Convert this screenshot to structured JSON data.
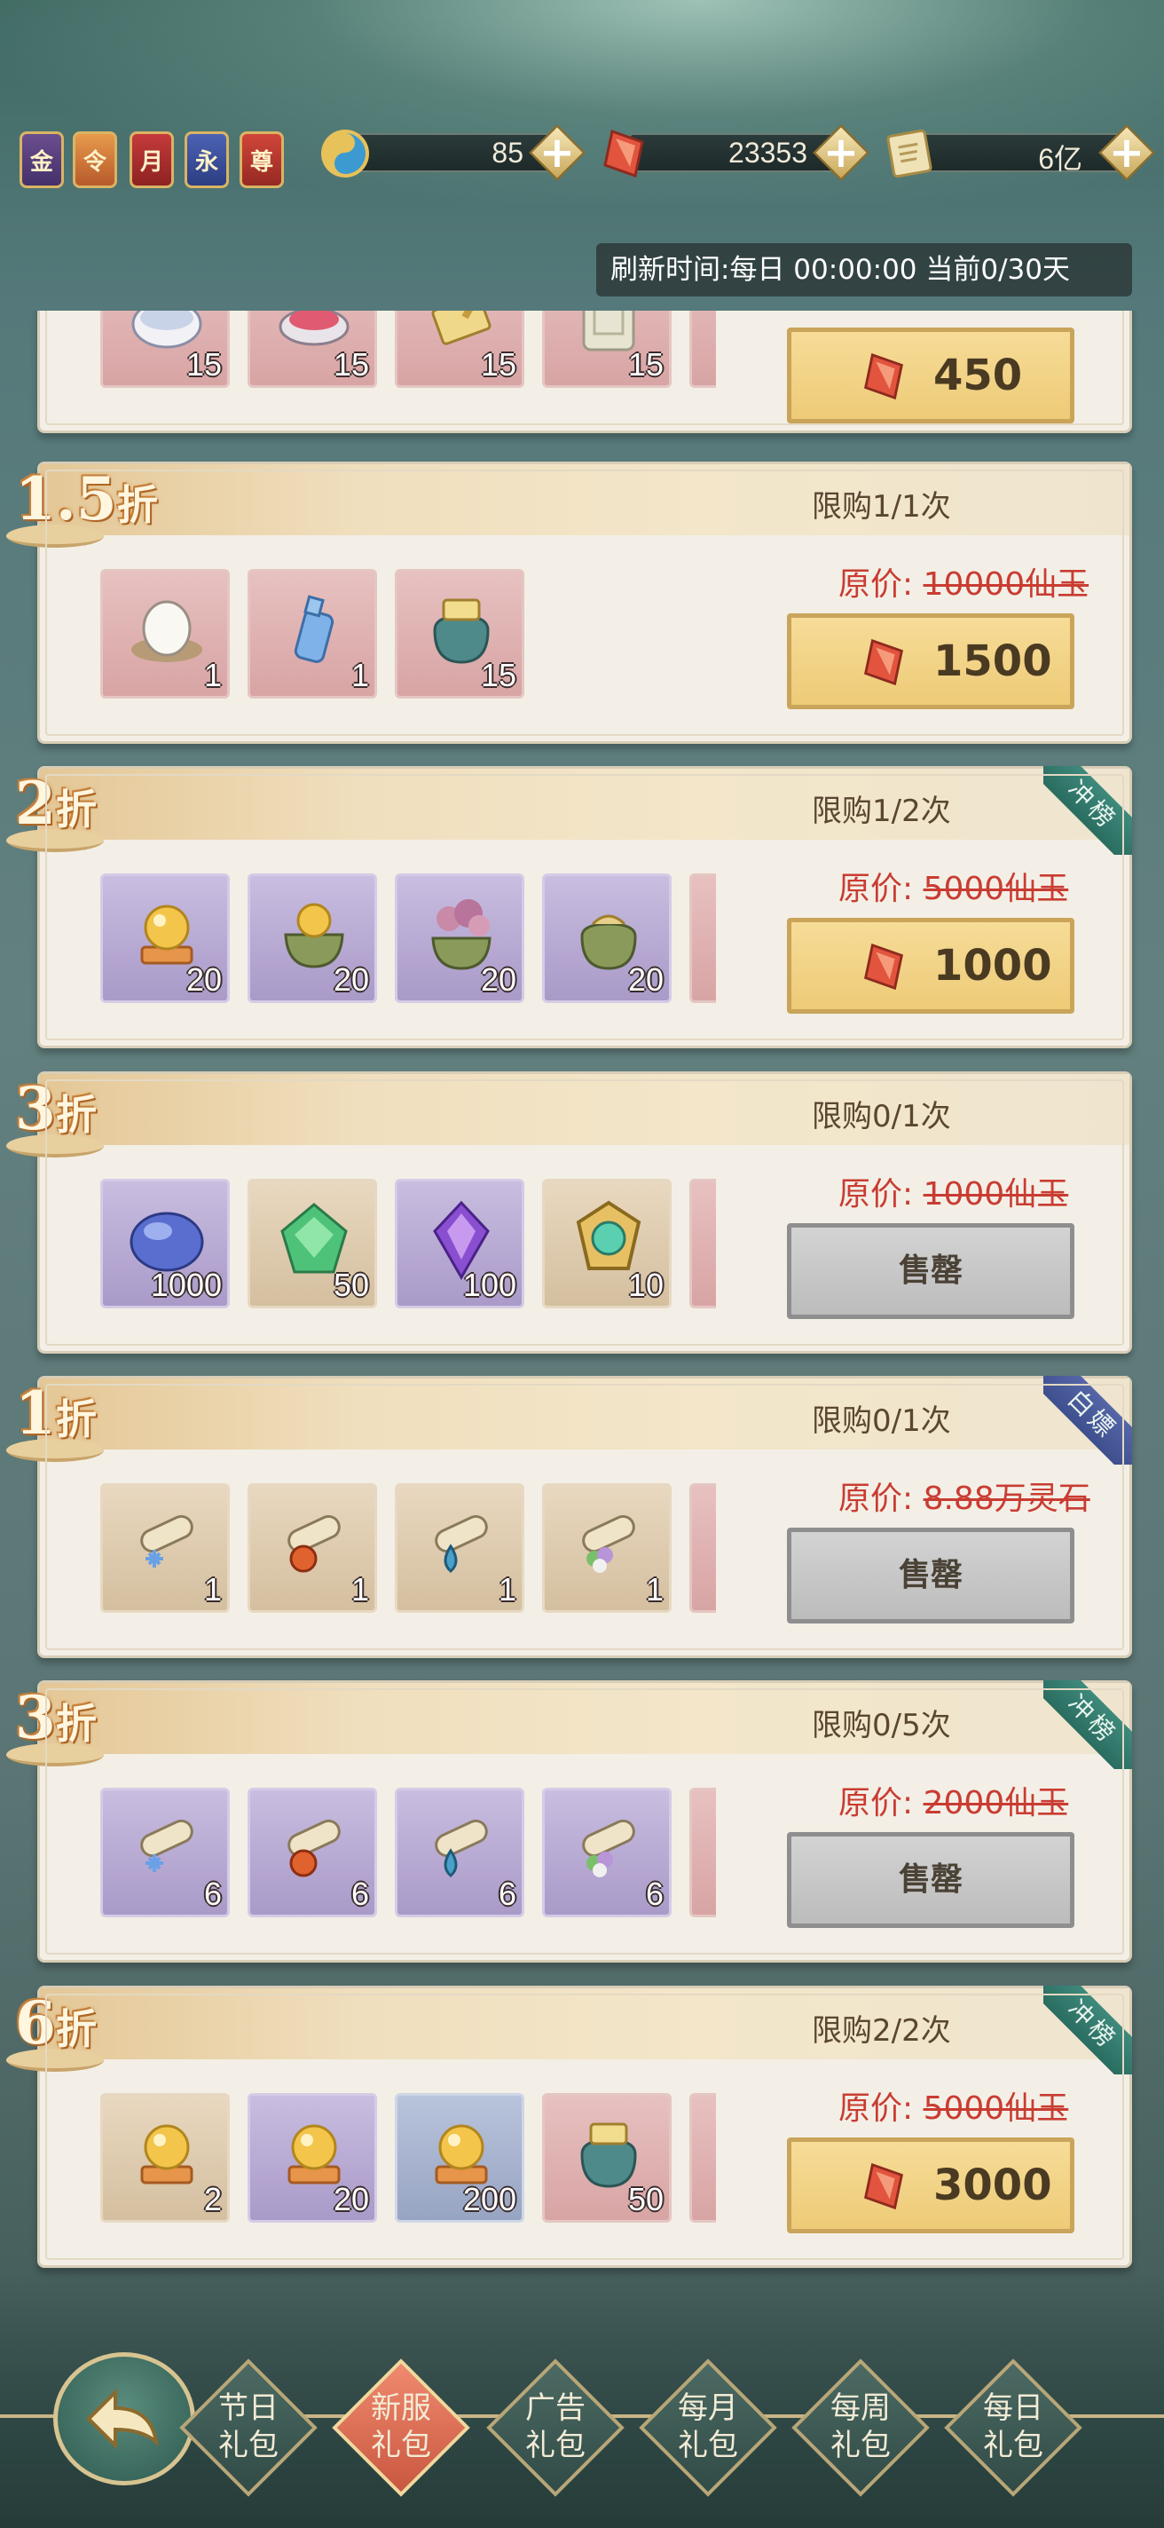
{
  "resources": {
    "badges": [
      "金",
      "令",
      "月",
      "永",
      "尊"
    ],
    "spirit": {
      "value": "85",
      "icon": "spirit-swirl-icon"
    },
    "jade": {
      "value": "23353",
      "icon": "red-jade-icon"
    },
    "stone": {
      "value": "6亿",
      "icon": "scroll-stone-icon"
    }
  },
  "refresh_text": "刷新时间:每日 00:00:00 当前0/30天",
  "packs": [
    {
      "discount": "",
      "zhe": "",
      "limit": "",
      "orig_label": "",
      "orig_value": "",
      "price": "450",
      "sold_out": false,
      "items": [
        {
          "qty": "15",
          "bg": "pink",
          "icon": "porcelain-bowl-icon"
        },
        {
          "qty": "15",
          "bg": "pink",
          "icon": "rouge-box-icon"
        },
        {
          "qty": "15",
          "bg": "pink",
          "icon": "golden-scroll-icon"
        },
        {
          "qty": "15",
          "bg": "pink",
          "icon": "jade-tablet-icon"
        }
      ]
    },
    {
      "discount": "1.5",
      "zhe": "折",
      "limit": "限购1/1次",
      "orig_label": "原价: ",
      "orig_value": "10000仙玉",
      "price": "1500",
      "sold_out": false,
      "tag": "",
      "items": [
        {
          "qty": "1",
          "bg": "pink",
          "icon": "egg-nest-icon"
        },
        {
          "qty": "1",
          "bg": "pink",
          "icon": "blue-bottle-icon"
        },
        {
          "qty": "15",
          "bg": "pink",
          "icon": "treasure-bag-icon"
        }
      ]
    },
    {
      "discount": "2",
      "zhe": "折",
      "limit": "限购1/2次",
      "orig_label": "原价: ",
      "orig_value": "5000仙玉",
      "price": "1000",
      "sold_out": false,
      "tag": "冲榜",
      "tag_color": "green",
      "items": [
        {
          "qty": "20",
          "bg": "purple",
          "icon": "golden-orb-icon"
        },
        {
          "qty": "20",
          "bg": "purple",
          "icon": "orb-cauldron-icon"
        },
        {
          "qty": "20",
          "bg": "purple",
          "icon": "smoke-cauldron-icon"
        },
        {
          "qty": "20",
          "bg": "purple",
          "icon": "green-pouch-icon"
        }
      ]
    },
    {
      "discount": "3",
      "zhe": "折",
      "limit": "限购0/1次",
      "orig_label": "原价: ",
      "orig_value": "1000仙玉",
      "sold_out": true,
      "sold_out_label": "售罄",
      "tag": "",
      "items": [
        {
          "qty": "1000",
          "bg": "purple",
          "icon": "blue-stone-icon"
        },
        {
          "qty": "50",
          "bg": "tan",
          "icon": "green-leaf-gem-icon"
        },
        {
          "qty": "100",
          "bg": "purple",
          "icon": "purple-gem-icon"
        },
        {
          "qty": "10",
          "bg": "tan",
          "icon": "jade-amulet-icon"
        }
      ]
    },
    {
      "discount": "1",
      "zhe": "折",
      "limit": "限购0/1次",
      "orig_label": "原价: ",
      "orig_value": "8.88万灵石",
      "sold_out": true,
      "sold_out_label": "售罄",
      "tag": "白嫖",
      "tag_color": "blue",
      "items": [
        {
          "qty": "1",
          "bg": "tan",
          "icon": "frost-scroll-icon"
        },
        {
          "qty": "1",
          "bg": "tan",
          "icon": "fire-scroll-icon"
        },
        {
          "qty": "1",
          "bg": "tan",
          "icon": "water-scroll-icon"
        },
        {
          "qty": "1",
          "bg": "tan",
          "icon": "flower-scroll-icon"
        }
      ]
    },
    {
      "discount": "3",
      "zhe": "折",
      "limit": "限购0/5次",
      "orig_label": "原价: ",
      "orig_value": "2000仙玉",
      "sold_out": true,
      "sold_out_label": "售罄",
      "tag": "冲榜",
      "tag_color": "green",
      "items": [
        {
          "qty": "6",
          "bg": "purple",
          "icon": "frost-scroll-icon"
        },
        {
          "qty": "6",
          "bg": "purple",
          "icon": "fire-scroll-icon"
        },
        {
          "qty": "6",
          "bg": "purple",
          "icon": "water-scroll-icon"
        },
        {
          "qty": "6",
          "bg": "purple",
          "icon": "flower-scroll-icon"
        }
      ]
    },
    {
      "discount": "6",
      "zhe": "折",
      "limit": "限购2/2次",
      "orig_label": "原价: ",
      "orig_value": "5000仙玉",
      "price": "3000",
      "sold_out": false,
      "tag": "冲榜",
      "tag_color": "green",
      "items": [
        {
          "qty": "2",
          "bg": "tan",
          "icon": "golden-orb-icon"
        },
        {
          "qty": "20",
          "bg": "purple",
          "icon": "golden-orb-icon"
        },
        {
          "qty": "200",
          "bg": "blue",
          "icon": "golden-orb-icon"
        },
        {
          "qty": "50",
          "bg": "pink",
          "icon": "treasure-bag-icon"
        }
      ]
    }
  ],
  "nav": {
    "back_icon": "back-arrow-icon",
    "tabs": [
      {
        "line1": "节日",
        "line2": "礼包",
        "active": false
      },
      {
        "line1": "新服",
        "line2": "礼包",
        "active": true
      },
      {
        "line1": "广告",
        "line2": "礼包",
        "active": false
      },
      {
        "line1": "每月",
        "line2": "礼包",
        "active": false
      },
      {
        "line1": "每周",
        "line2": "礼包",
        "active": false
      },
      {
        "line1": "每日",
        "line2": "礼包",
        "active": false
      }
    ]
  },
  "colors": {
    "accent_red": "#c93c32",
    "gold_button": "#edcb77",
    "sold_out_button": "#bcbcbc",
    "active_tab": "#e0705a"
  }
}
